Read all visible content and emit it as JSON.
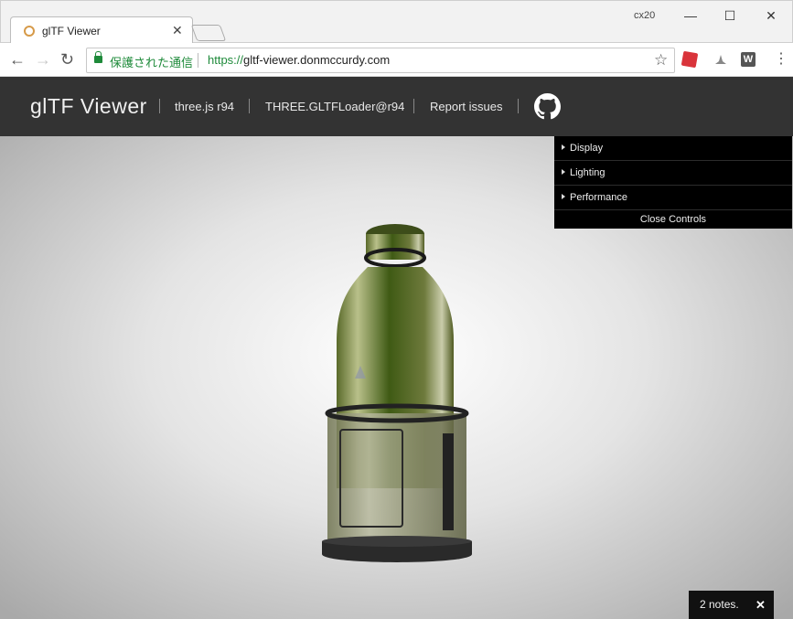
{
  "browser": {
    "tab_title": "glTF Viewer",
    "tab_close": "✕",
    "profile_label": "cx20",
    "window_minimize": "—",
    "window_maximize": "☐",
    "window_close": "✕",
    "nav_back": "←",
    "nav_forward": "→",
    "nav_reload": "↻",
    "secure_label": "保護された通信",
    "url_scheme": "https://",
    "url_host": "gltf-viewer.donmccurdy.com",
    "bookmark_star": "☆",
    "extension_w": "W",
    "menu": "⋮"
  },
  "header": {
    "title": "glTF Viewer",
    "links": [
      {
        "label": "three.js r94"
      },
      {
        "label": "THREE.GLTFLoader@r94"
      },
      {
        "label": "Report issues"
      }
    ]
  },
  "controls": {
    "folders": [
      {
        "label": "Display"
      },
      {
        "label": "Lighting"
      },
      {
        "label": "Performance"
      }
    ],
    "close_label": "Close Controls"
  },
  "notes": {
    "label": "2 notes.",
    "close": "✕"
  },
  "colors": {
    "header_bg": "#333333",
    "panel_bg": "#000000",
    "secure_green": "#1e8a3a"
  }
}
